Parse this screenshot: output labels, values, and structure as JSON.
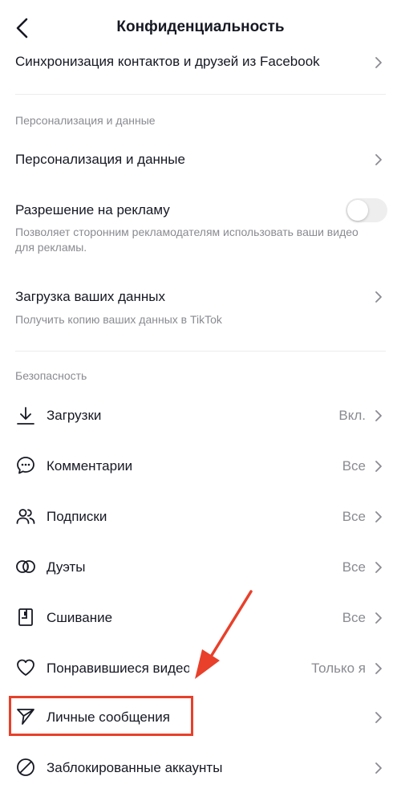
{
  "header": {
    "title": "Конфиденциальность",
    "back_icon": "chevron-left-icon"
  },
  "rows": {
    "facebook_sync": {
      "label": "Синхронизация контактов и друзей из Facebook"
    },
    "personalization": {
      "label": "Персонализация и данные"
    },
    "ads": {
      "label": "Разрешение на рекламу",
      "desc": "Позволяет сторонним рекламодателям использовать ваши видео для рекламы.",
      "toggle_on": false
    },
    "download_data": {
      "label": "Загрузка ваших данных",
      "desc": "Получить копию ваших данных в TikTok"
    }
  },
  "sections": {
    "personalization": "Персонализация и данные",
    "security": "Безопасность"
  },
  "security_items": [
    {
      "label": "Загрузки",
      "value": "Вкл.",
      "icon": "download-icon"
    },
    {
      "label": "Комментарии",
      "value": "Все",
      "icon": "comment-icon"
    },
    {
      "label": "Подписки",
      "value": "Все",
      "icon": "people-icon"
    },
    {
      "label": "Дуэты",
      "value": "Все",
      "icon": "duet-icon"
    },
    {
      "label": "Сшивание",
      "value": "Все",
      "icon": "stitch-icon"
    },
    {
      "label": "Понравившиеся видео",
      "value": "Только я",
      "icon": "heart-icon"
    },
    {
      "label": "Личные сообщения",
      "value": "",
      "icon": "send-icon"
    },
    {
      "label": "Заблокированные аккаунты",
      "value": "",
      "icon": "block-icon"
    }
  ],
  "colors": {
    "text": "#161823",
    "secondary": "#8a8b91",
    "highlight": "#e8402a",
    "toggle_off": "#eeeeef"
  }
}
